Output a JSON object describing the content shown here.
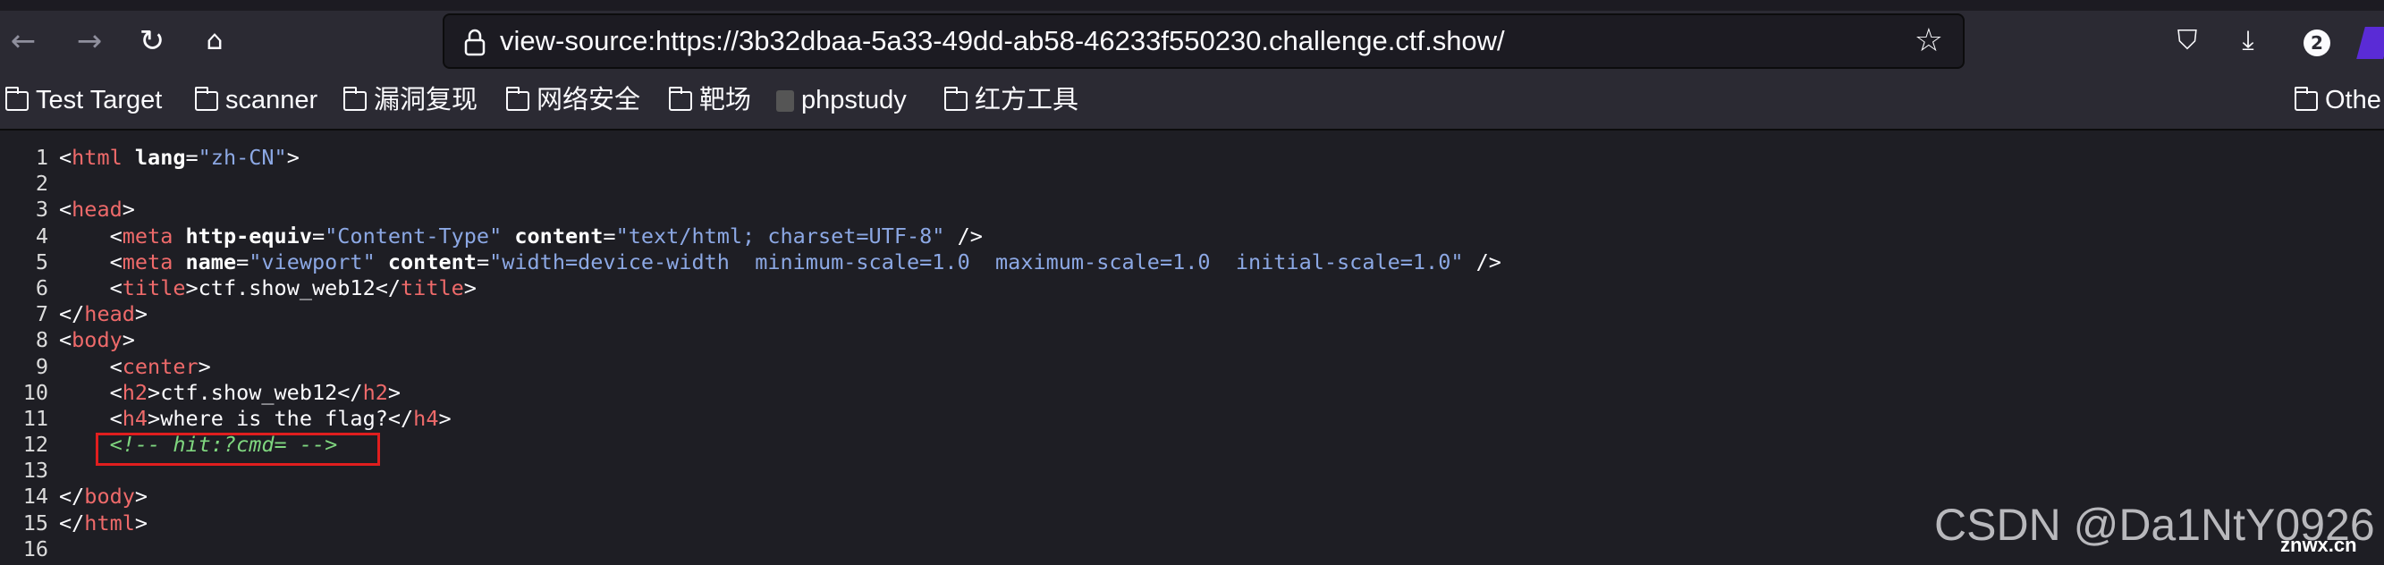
{
  "browser": {
    "url": "view-source:https://3b32dbaa-5a33-49dd-ab58-46233f550230.challenge.ctf.show/",
    "downloads_badge": "2"
  },
  "bookmarks": [
    {
      "label": "Test Target",
      "icon": "folder-icon"
    },
    {
      "label": "scanner",
      "icon": "folder-icon"
    },
    {
      "label": "漏洞复现",
      "icon": "folder-icon"
    },
    {
      "label": "网络安全",
      "icon": "folder-icon"
    },
    {
      "label": "靶场",
      "icon": "folder-icon"
    },
    {
      "label": "phpstudy",
      "icon": "phpstudy-icon"
    },
    {
      "label": "红方工具",
      "icon": "folder-icon"
    }
  ],
  "other_bookmarks": "Othe",
  "source_lines": [
    "1",
    "2",
    "3",
    "4",
    "5",
    "6",
    "7",
    "8",
    "9",
    "10",
    "11",
    "12",
    "13",
    "14",
    "15",
    "16"
  ],
  "source": {
    "l1_tag": "html",
    "l1_attr": "lang",
    "l1_val": "\"zh-CN\"",
    "l3_tag": "head",
    "l4_tag": "meta",
    "l4_attr1": "http-equiv",
    "l4_val1": "\"Content-Type\"",
    "l4_attr2": "content",
    "l4_val2": "\"text/html; charset=UTF-8\"",
    "l5_tag": "meta",
    "l5_attr1": "name",
    "l5_val1": "\"viewport\"",
    "l5_attr2": "content",
    "l5_val2": "\"width=device-width  minimum-scale=1.0  maximum-scale=1.0  initial-scale=1.0\"",
    "l6_tag": "title",
    "l6_text": "ctf.show_web12",
    "l7_tag": "head",
    "l8_tag": "body",
    "l9_tag": "center",
    "l10_tag": "h2",
    "l10_text": "ctf.show_web12",
    "l11_tag": "h4",
    "l11_text": "where is the flag?",
    "l12_comment": "<!-- hit:?cmd= -->",
    "l14_tag": "body",
    "l15_tag": "html"
  },
  "watermark": "CSDN @Da1NtY0926",
  "watermark2": "znwx.cn",
  "colors": {
    "tag": "#ee6a6a",
    "attr_value": "#8ca8e4",
    "comment": "#7fd67f",
    "highlight_box": "#e01e1e"
  }
}
